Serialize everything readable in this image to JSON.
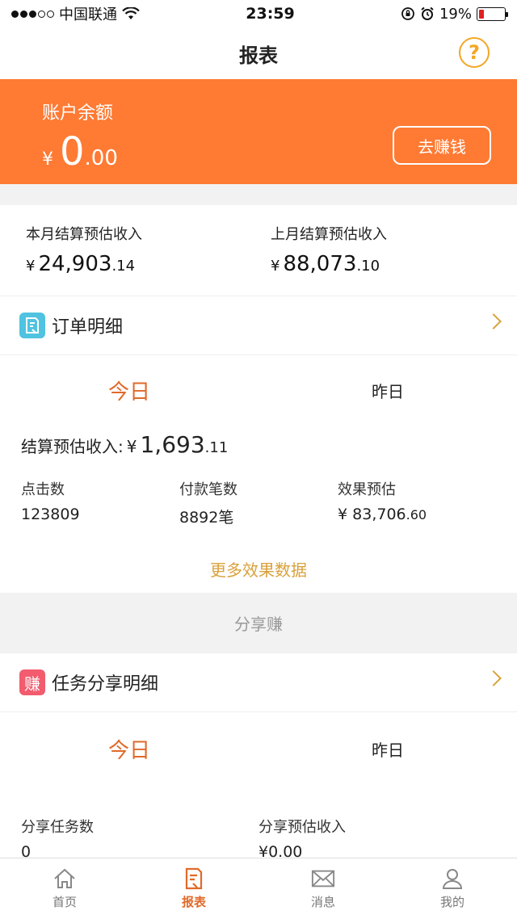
{
  "status_bar": {
    "carrier": "中国联通",
    "time": "23:59",
    "battery": "19%",
    "battery_level": 0.19
  },
  "nav": {
    "title": "报表"
  },
  "balance": {
    "label": "账户余额",
    "currency": "¥",
    "int": "0",
    "dec": ".00",
    "earn_button": "去赚钱"
  },
  "month": {
    "this_label": "本月结算预估收入",
    "this_int": "24,903",
    "this_dec": ".14",
    "last_label": "上月结算预估收入",
    "last_int": "88,073",
    "last_dec": ".10",
    "currency": "¥"
  },
  "order": {
    "title": "订单明细",
    "tabs": [
      "今日",
      "昨日"
    ],
    "settle_label": "结算预估收入:",
    "settle_int": "1,693",
    "settle_dec": ".11",
    "clicks_label": "点击数",
    "clicks": "123809",
    "payments_label": "付款笔数",
    "payments": "8892笔",
    "effect_label": "效果预估",
    "effect_int": "83,706",
    "effect_dec": ".60",
    "more": "更多效果数据"
  },
  "share": {
    "section": "分享赚",
    "icon_char": "赚",
    "title": "任务分享明细",
    "tabs": [
      "今日",
      "昨日"
    ],
    "tasks_label": "分享任务数",
    "tasks": "0",
    "income_label": "分享预估收入",
    "income": "0.00"
  },
  "tabbar": [
    {
      "label": "首页",
      "icon": "home-icon"
    },
    {
      "label": "报表",
      "icon": "report-icon"
    },
    {
      "label": "消息",
      "icon": "mail-icon"
    },
    {
      "label": "我的",
      "icon": "user-icon"
    }
  ],
  "colors": {
    "accent": "#ff7a33",
    "gold": "#d9a13b",
    "tab_active": "#e06a2a"
  }
}
